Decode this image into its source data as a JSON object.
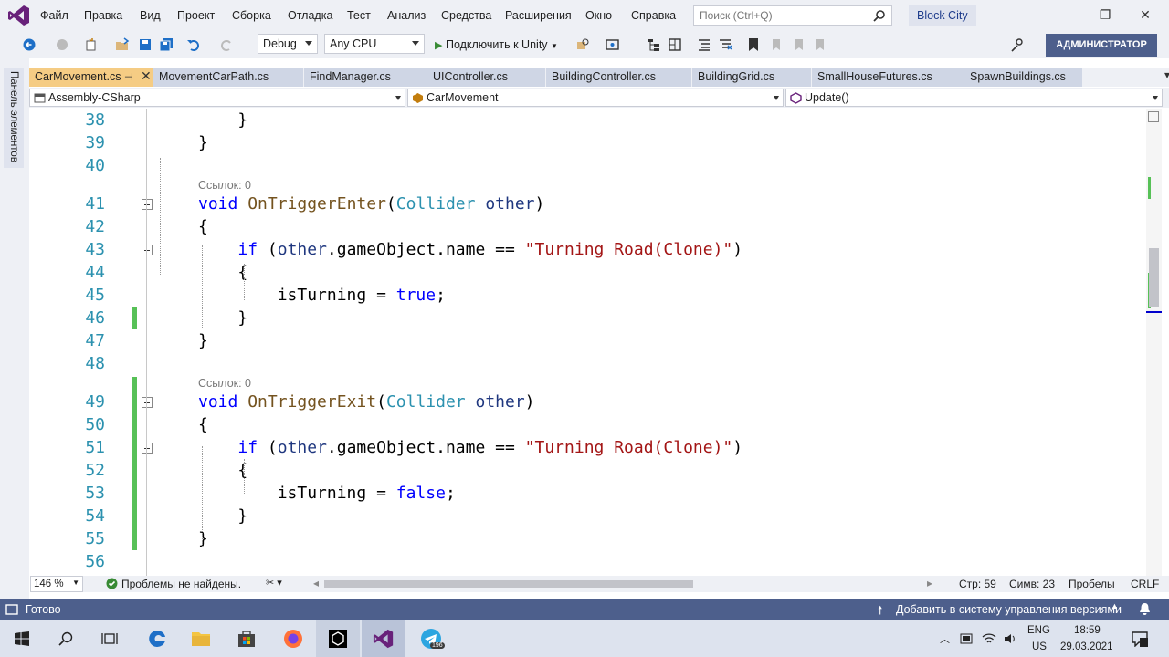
{
  "title_bar": {
    "menu": [
      "Файл",
      "Правка",
      "Вид",
      "Проект",
      "Сборка",
      "Отладка",
      "Тест",
      "Анализ",
      "Средства",
      "Расширения",
      "Окно",
      "Справка"
    ],
    "search_placeholder": "Поиск (Ctrl+Q)",
    "solution": "Block City"
  },
  "toolbar": {
    "config": "Debug",
    "platform": "Any CPU",
    "attach": "Подключить к Unity",
    "admin": "АДМИНИСТРАТОР"
  },
  "sidebar": {
    "label": "Панель элементов"
  },
  "tabs": [
    {
      "label": "CarMovement.cs"
    },
    {
      "label": "MovementCarPath.cs"
    },
    {
      "label": "FindManager.cs"
    },
    {
      "label": "UIController.cs"
    },
    {
      "label": "BuildingController.cs"
    },
    {
      "label": "BuildingGrid.cs"
    },
    {
      "label": "SmallHouseFutures.cs"
    },
    {
      "label": "SpawnBuildings.cs"
    }
  ],
  "navbar": {
    "project": "Assembly-CSharp",
    "class": "CarMovement",
    "member": "Update()"
  },
  "editor": {
    "lines": [
      {
        "n": "38",
        "t": [
          [
            "    }",
            ""
          ]
        ]
      },
      {
        "n": "39",
        "t": [
          [
            "}",
            ""
          ]
        ]
      },
      {
        "n": "40",
        "t": []
      },
      {
        "n": "41",
        "t": [
          [
            "void",
            "kw"
          ],
          [
            " ",
            ""
          ],
          [
            "OnTriggerEnter",
            "mt"
          ],
          [
            "(",
            ""
          ],
          [
            "Collider",
            "ty"
          ],
          [
            " ",
            ""
          ],
          [
            "other",
            "id"
          ],
          [
            ")",
            ""
          ]
        ]
      },
      {
        "n": "42",
        "t": [
          [
            "{",
            ""
          ]
        ]
      },
      {
        "n": "43",
        "t": [
          [
            "    ",
            ""
          ],
          [
            "if",
            "kw"
          ],
          [
            " (",
            ""
          ],
          [
            "other",
            "id"
          ],
          [
            ".gameObject.name == ",
            ""
          ],
          [
            "\"Turning Road(Clone)\"",
            "st"
          ],
          [
            ")",
            ""
          ]
        ]
      },
      {
        "n": "44",
        "t": [
          [
            "    {",
            ""
          ]
        ]
      },
      {
        "n": "45",
        "t": [
          [
            "        isTurning = ",
            ""
          ],
          [
            "true",
            "kw"
          ],
          [
            ";",
            ""
          ]
        ]
      },
      {
        "n": "46",
        "t": [
          [
            "    }",
            ""
          ]
        ]
      },
      {
        "n": "47",
        "t": [
          [
            "}",
            ""
          ]
        ]
      },
      {
        "n": "48",
        "t": []
      },
      {
        "n": "49",
        "t": [
          [
            "void",
            "kw"
          ],
          [
            " ",
            ""
          ],
          [
            "OnTriggerExit",
            "mt"
          ],
          [
            "(",
            ""
          ],
          [
            "Collider",
            "ty"
          ],
          [
            " ",
            ""
          ],
          [
            "other",
            "id"
          ],
          [
            ")",
            ""
          ]
        ]
      },
      {
        "n": "50",
        "t": [
          [
            "{",
            ""
          ]
        ]
      },
      {
        "n": "51",
        "t": [
          [
            "    ",
            ""
          ],
          [
            "if",
            "kw"
          ],
          [
            " (",
            ""
          ],
          [
            "other",
            "id"
          ],
          [
            ".gameObject.name == ",
            ""
          ],
          [
            "\"Turning Road(Clone)\"",
            "st"
          ],
          [
            ")",
            ""
          ]
        ]
      },
      {
        "n": "52",
        "t": [
          [
            "    {",
            ""
          ]
        ]
      },
      {
        "n": "53",
        "t": [
          [
            "        isTurning = ",
            ""
          ],
          [
            "false",
            "kw"
          ],
          [
            ";",
            ""
          ]
        ]
      },
      {
        "n": "54",
        "t": [
          [
            "    }",
            ""
          ]
        ]
      },
      {
        "n": "55",
        "t": [
          [
            "}",
            ""
          ]
        ]
      },
      {
        "n": "56",
        "t": []
      }
    ],
    "refs": "Ссылок: 0"
  },
  "editor_status": {
    "zoom": "146 %",
    "problems": "Проблемы не найдены.",
    "line": "Стр: 59",
    "col": "Симв: 23",
    "ws": "Пробелы",
    "eol": "CRLF"
  },
  "status": {
    "ready": "Готово",
    "vcs": "Добавить в систему управления версиями"
  },
  "taskbar": {
    "lang": "ENG",
    "kb": "US",
    "time": "18:59",
    "date": "29.03.2021",
    "badge": "196"
  }
}
